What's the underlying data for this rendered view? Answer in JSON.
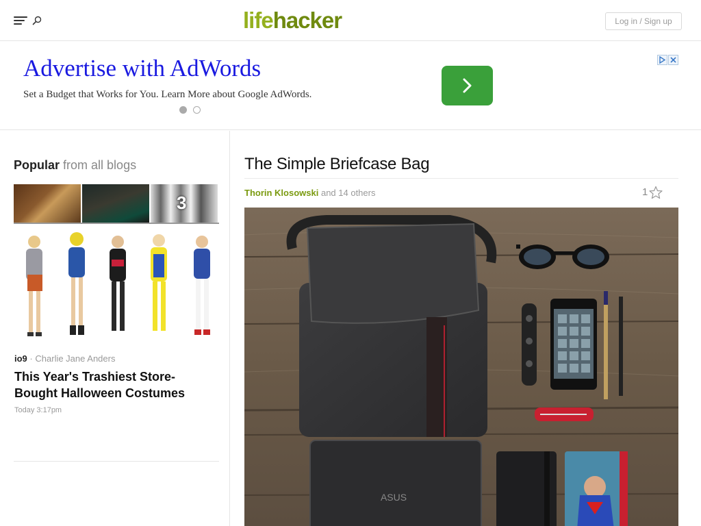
{
  "header": {
    "logo_part1": "life",
    "logo_part2": "hacker",
    "login_label": "Log in / Sign up",
    "icons": [
      "hamburger-menu-icon",
      "search-icon"
    ]
  },
  "ad": {
    "title": "Advertise with AdWords",
    "description": "Set a Budget that Works for You. Learn More about Google AdWords.",
    "button_color": "#3aa03a",
    "title_color": "#1a1ae0"
  },
  "sidebar": {
    "popular_label": "Popular",
    "popular_sub": "from all blogs",
    "thumb_count": "3",
    "story": {
      "blog": "io9",
      "separator": "·",
      "author": "Charlie Jane Anders",
      "headline": "This Year's Trashiest Store-Bought Halloween Costumes",
      "time": "Today 3:17pm"
    }
  },
  "article": {
    "title": "The Simple Briefcase Bag",
    "author": "Thorin Klosowski",
    "others": "and 14 others",
    "likes": "1",
    "hero_brand": "ASUS",
    "author_color": "#7a9a0f"
  }
}
